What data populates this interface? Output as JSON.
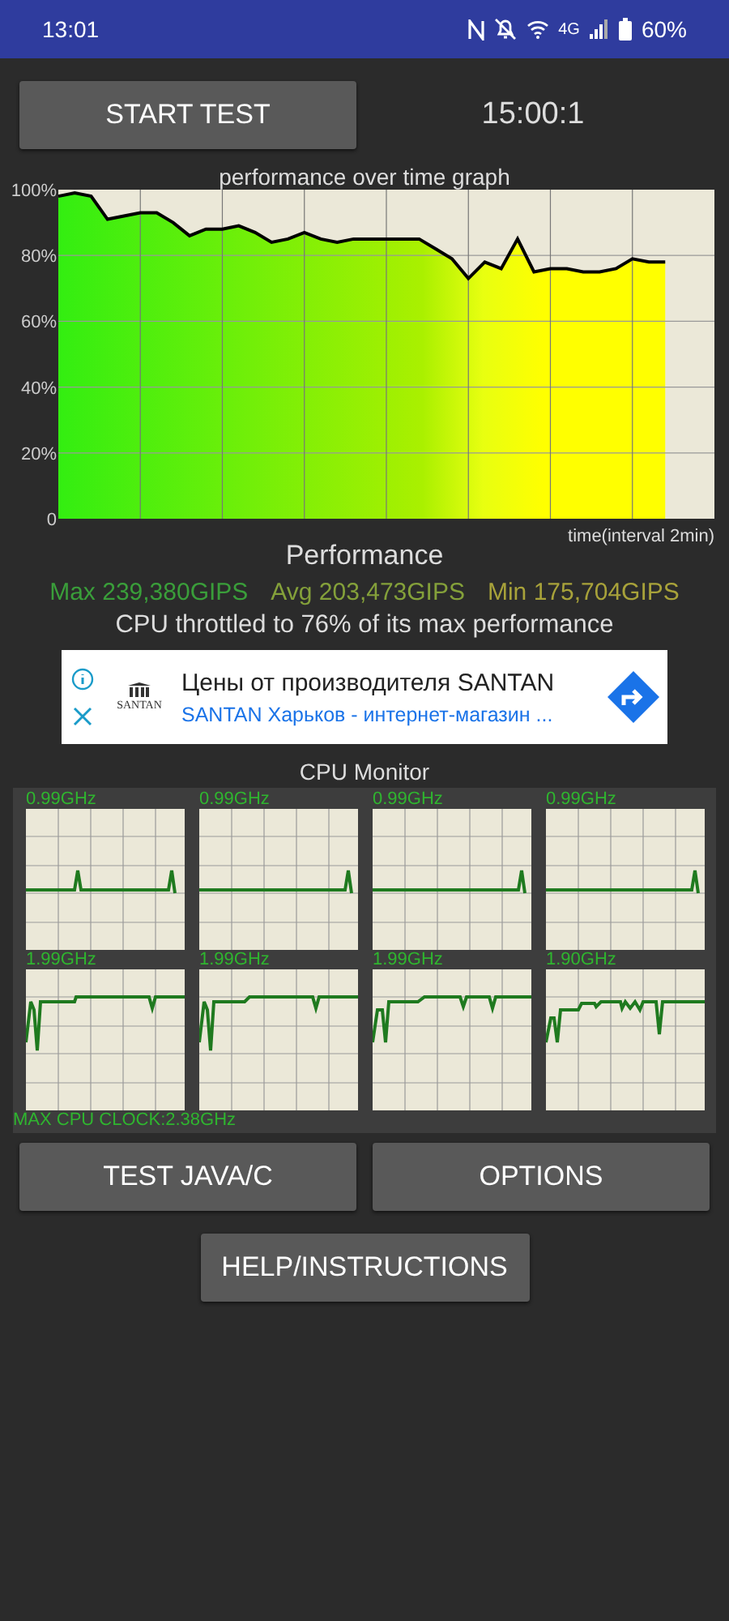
{
  "status_bar": {
    "time": "13:01",
    "network": "4G",
    "battery": "60%"
  },
  "start_button": "START TEST",
  "timer": "15:00:1",
  "performance_graph": {
    "chart_data": {
      "type": "line",
      "title": "performance over time graph",
      "xlabel": "time(interval 2min)",
      "grid": true,
      "ylim": [
        0,
        100
      ],
      "yticks": [
        {
          "value": 0,
          "label": "0"
        },
        {
          "value": 20,
          "label": "20%"
        },
        {
          "value": 40,
          "label": "40%"
        },
        {
          "value": 60,
          "label": "60%"
        },
        {
          "value": 80,
          "label": "80%"
        },
        {
          "value": 100,
          "label": "100%"
        }
      ],
      "categories": [
        null,
        null,
        null,
        null,
        null,
        null,
        null,
        null,
        null,
        null,
        null,
        null,
        null,
        null,
        null,
        null,
        null,
        null,
        null,
        null,
        null,
        null,
        null,
        null,
        null,
        null,
        null,
        null,
        null,
        null,
        null,
        null,
        null,
        null,
        null,
        null,
        null,
        null,
        null,
        null,
        null
      ],
      "series": [
        {
          "color": "#000000",
          "values": [
            98,
            99,
            98,
            91,
            92,
            93,
            93,
            90,
            86,
            88,
            88,
            89,
            87,
            84,
            85,
            87,
            85,
            84,
            85,
            85,
            85,
            85,
            85,
            82,
            79,
            73,
            78,
            76,
            85,
            75,
            76,
            76,
            75,
            75,
            76,
            79,
            78,
            78,
            null,
            null,
            null
          ]
        }
      ]
    }
  },
  "performance": {
    "title": "Performance",
    "max": "Max 239,380GIPS",
    "avg": "Avg 203,473GIPS",
    "min": "Min 175,704GIPS",
    "throttle": "CPU throttled to 76% of its max performance"
  },
  "ad": {
    "logo_text": "SANTAN",
    "title": "Цены от производителя SANTAN",
    "subtitle": "SANTAN Харьков - интернет-магазин ..."
  },
  "cpu_monitor": {
    "title": "CPU Monitor",
    "cores": [
      {
        "freq": "0.99GHz"
      },
      {
        "freq": "0.99GHz"
      },
      {
        "freq": "0.99GHz"
      },
      {
        "freq": "0.99GHz"
      },
      {
        "freq": "1.99GHz"
      },
      {
        "freq": "1.99GHz"
      },
      {
        "freq": "1.99GHz"
      },
      {
        "freq": "1.90GHz"
      }
    ],
    "max_clock": "MAX CPU CLOCK:2.38GHz"
  },
  "buttons": [
    "TEST JAVA/C",
    "OPTIONS"
  ],
  "help_button": "HELP/INSTRUCTIONS"
}
